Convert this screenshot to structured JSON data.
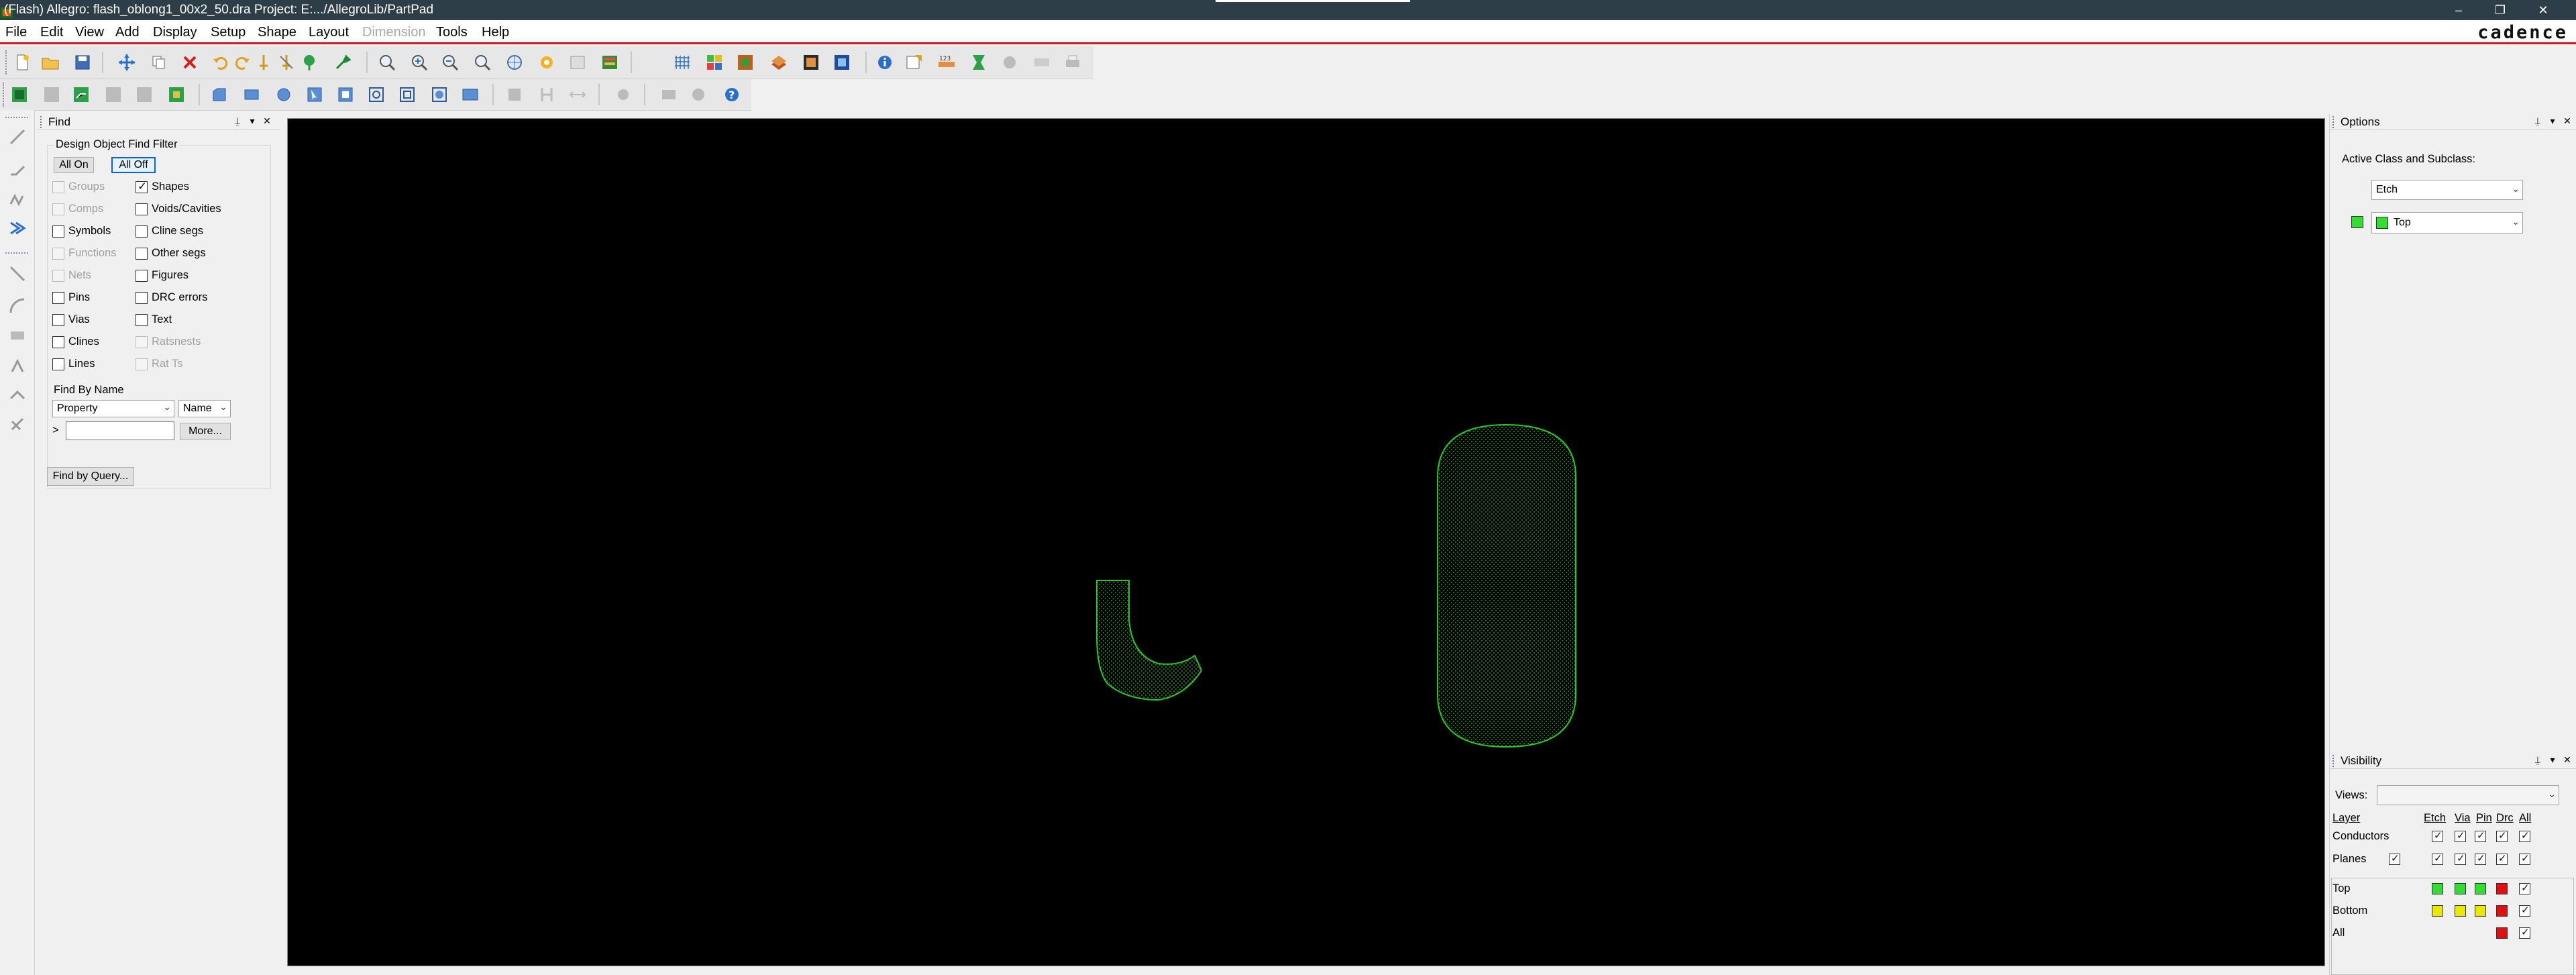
{
  "window": {
    "title": "(Flash) Allegro: flash_oblong1_00x2_50.dra  Project: E:.../AllegroLib/PartPad",
    "minimize_glyph": "–",
    "restore_glyph": "❐",
    "close_glyph": "✕"
  },
  "menubar": {
    "items": [
      "File",
      "Edit",
      "View",
      "Add",
      "Display",
      "Setup",
      "Shape",
      "Layout",
      "Dimension",
      "Tools",
      "Help"
    ],
    "disabled": [
      "Dimension"
    ],
    "brand": "cadence"
  },
  "colors": {
    "titlebar": "#2e3e48",
    "accent_line": "#e0121c",
    "canvas_bg": "#000000",
    "etch_top": "#22cc22",
    "cursor": "#b0a040",
    "layer_top": "#33dd33",
    "layer_bottom": "#e8e800",
    "drc": "#e01010"
  },
  "find_panel": {
    "title": "Find",
    "filter_title": "Design Object Find Filter",
    "all_on": "All On",
    "all_off": "All Off",
    "left_column": [
      {
        "label": "Groups",
        "checked": false,
        "enabled": false
      },
      {
        "label": "Comps",
        "checked": false,
        "enabled": false
      },
      {
        "label": "Symbols",
        "checked": false,
        "enabled": true
      },
      {
        "label": "Functions",
        "checked": false,
        "enabled": false
      },
      {
        "label": "Nets",
        "checked": false,
        "enabled": false
      },
      {
        "label": "Pins",
        "checked": false,
        "enabled": true
      },
      {
        "label": "Vias",
        "checked": false,
        "enabled": true
      },
      {
        "label": "Clines",
        "checked": false,
        "enabled": true
      },
      {
        "label": "Lines",
        "checked": false,
        "enabled": true
      }
    ],
    "right_column": [
      {
        "label": "Shapes",
        "checked": true,
        "enabled": true
      },
      {
        "label": "Voids/Cavities",
        "checked": false,
        "enabled": true
      },
      {
        "label": "Cline segs",
        "checked": false,
        "enabled": true
      },
      {
        "label": "Other segs",
        "checked": false,
        "enabled": true
      },
      {
        "label": "Figures",
        "checked": false,
        "enabled": true
      },
      {
        "label": "DRC errors",
        "checked": false,
        "enabled": true
      },
      {
        "label": "Text",
        "checked": false,
        "enabled": true
      },
      {
        "label": "Ratsnests",
        "checked": false,
        "enabled": false
      },
      {
        "label": "Rat Ts",
        "checked": false,
        "enabled": false
      }
    ],
    "find_by_name_title": "Find By Name",
    "property_select": "Property",
    "name_select": "Name",
    "prompt_glyph": ">",
    "name_input_value": "",
    "more_button": "More...",
    "find_by_query_button": "Find by Query..."
  },
  "options_panel": {
    "title": "Options",
    "active_class_label": "Active Class and Subclass:",
    "class_value": "Etch",
    "subclass_value": "Top"
  },
  "visibility_panel": {
    "title": "Visibility",
    "views_label": "Views:",
    "views_value": "",
    "layer_header": "Layer",
    "column_headers": [
      "Etch",
      "Via",
      "Pin",
      "Drc",
      "All"
    ],
    "rows_top": [
      {
        "label": "Conductors",
        "checks": [
          true,
          true,
          true,
          true,
          true
        ]
      },
      {
        "label": "Planes",
        "planes_check": true,
        "checks": [
          true,
          true,
          true,
          true,
          true
        ]
      }
    ],
    "rows_layers": [
      {
        "label": "Top",
        "swatches": [
          "layer_top",
          "layer_top",
          "layer_top",
          "drc"
        ],
        "all": true
      },
      {
        "label": "Bottom",
        "swatches": [
          "layer_bottom",
          "layer_bottom",
          "layer_bottom",
          "drc"
        ],
        "all": true
      },
      {
        "label": "All",
        "swatches": [
          null,
          null,
          null,
          "drc"
        ],
        "all": true
      }
    ]
  },
  "toolbar_icons": {
    "row1": [
      "new-file-icon",
      "open-folder-icon",
      "save-icon",
      "move-icon",
      "copy-icon",
      "delete-icon",
      "undo-icon",
      "redo-icon",
      "pin-icon",
      "unpin-icon",
      "tack-icon",
      "zoom-fit-icon",
      "zoom-in-icon",
      "zoom-out-icon",
      "zoom-previous-icon",
      "zoom-world-icon",
      "refresh-icon",
      "redraw-icon",
      "3d-view-icon",
      "grid-icon",
      "layer-color-icon",
      "visibility-icon",
      "shadow-icon",
      "pin-number-icon",
      "info-icon",
      "measure-icon",
      "report-icon",
      "timer-icon",
      "db-doctor-icon",
      "plot-icon",
      "print-icon"
    ],
    "row2": [
      "etch-mode-icon",
      "place-mode-icon",
      "route-mode-icon",
      "fanout-icon",
      "slide-icon",
      "shape-icon",
      "rect-shape-icon",
      "circle-shape-icon",
      "select-shape-icon",
      "void-icon",
      "edit-boundary-icon",
      "merge-shapes-icon",
      "assign-net-icon",
      "layer-swap-icon",
      "spacing-icon",
      "via-icon",
      "constraint-icon",
      "pad-editor-icon",
      "help-icon"
    ]
  }
}
